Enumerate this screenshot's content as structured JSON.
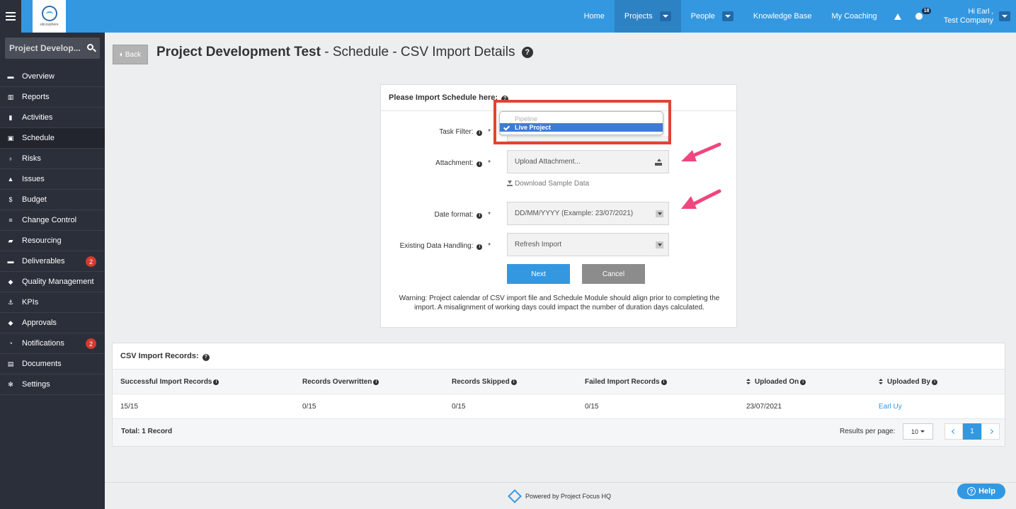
{
  "topbar": {
    "logo_text": "silicosphere",
    "nav": {
      "home": "Home",
      "projects": "Projects",
      "people": "People",
      "knowledge_base": "Knowledge Base",
      "my_coaching": "My Coaching"
    },
    "notification_count": "18",
    "user_greeting": "Hi Earl ,",
    "user_company": "Test Company",
    "accent_color": "#3498e0"
  },
  "sidebar": {
    "search_value": "Project Develop...",
    "items": [
      {
        "label": "Overview",
        "icon": "overview-icon"
      },
      {
        "label": "Reports",
        "icon": "bar-chart-icon"
      },
      {
        "label": "Activities",
        "icon": "bookmark-icon"
      },
      {
        "label": "Schedule",
        "icon": "calendar-icon"
      },
      {
        "label": "Risks",
        "icon": "lightbulb-icon"
      },
      {
        "label": "Issues",
        "icon": "warning-icon"
      },
      {
        "label": "Budget",
        "icon": "dollar-icon"
      },
      {
        "label": "Change Control",
        "icon": "list-icon"
      },
      {
        "label": "Resourcing",
        "icon": "folder-icon"
      },
      {
        "label": "Deliverables",
        "icon": "truck-icon",
        "badge": "2"
      },
      {
        "label": "Quality Management",
        "icon": "tag-icon"
      },
      {
        "label": "KPIs",
        "icon": "anchor-icon"
      },
      {
        "label": "Approvals",
        "icon": "tag-icon"
      },
      {
        "label": "Notifications",
        "icon": "bell-icon",
        "badge": "2"
      },
      {
        "label": "Documents",
        "icon": "documents-icon"
      },
      {
        "label": "Settings",
        "icon": "cogs-icon"
      }
    ]
  },
  "header": {
    "back_label": "Back",
    "title_project": "Project Development Test",
    "title_rest": " - Schedule - CSV Import Details"
  },
  "import_form": {
    "heading": "Please Import Schedule here:",
    "task_filter_label": "Task Filter:",
    "task_filter_options": [
      "Pipeline",
      "Live Project"
    ],
    "task_filter_selected": "Live Project",
    "attachment_label": "Attachment:",
    "attachment_placeholder": "Upload Attachment...",
    "download_sample_label": "Download Sample Data",
    "date_format_label": "Date format:",
    "date_format_value": "DD/MM/YYYY (Example: 23/07/2021)",
    "existing_data_label": "Existing Data Handling:",
    "existing_data_value": "Refresh Import",
    "required_mark": "*",
    "next_label": "Next",
    "cancel_label": "Cancel",
    "warning": "Warning: Project calendar of CSV import file and Schedule Module should align prior to completing the import. A misalignment of working days could impact the number of duration days calculated."
  },
  "records": {
    "heading": "CSV Import Records:",
    "columns": [
      "Successful Import Records",
      "Records Overwritten",
      "Records Skipped",
      "Failed Import Records",
      "Uploaded On",
      "Uploaded By"
    ],
    "rows": [
      {
        "successful": "15/15",
        "overwritten": "0/15",
        "skipped": "0/15",
        "failed": "0/15",
        "uploaded_on": "23/07/2021",
        "uploaded_by": "Earl Uy"
      }
    ],
    "total": "Total: 1 Record",
    "results_per_page_label": "Results per page:",
    "results_per_page_value": "10",
    "current_page": "1"
  },
  "footer": {
    "powered_by": "Powered by Project Focus HQ",
    "help_label": "Help"
  },
  "annotations": {
    "highlight_color": "#e0452f",
    "arrow_color": "#f0457e"
  }
}
